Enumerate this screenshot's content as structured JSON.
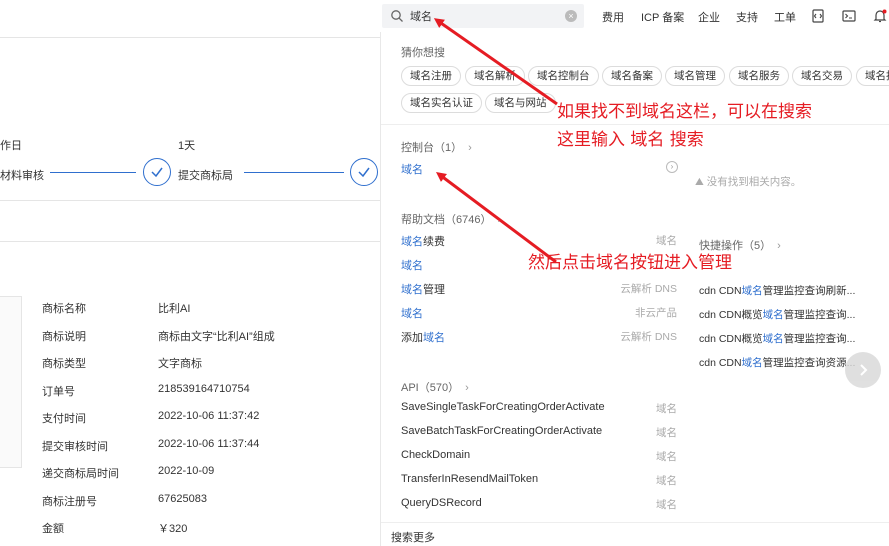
{
  "search": {
    "value": "域名"
  },
  "nav": [
    {
      "label": "费用"
    },
    {
      "label": "ICP 备案"
    },
    {
      "label": "企业"
    },
    {
      "label": "支持"
    },
    {
      "label": "工单"
    }
  ],
  "background": {
    "steps": {
      "label_top_1": "作日",
      "label_top_2": "1天",
      "step_1": "材料审核",
      "step_2": "提交商标局"
    },
    "info": [
      {
        "label": "商标名称",
        "value": "比利AI"
      },
      {
        "label": "商标说明",
        "value": "商标由文字“比利AI”组成"
      },
      {
        "label": "商标类型",
        "value": "文字商标"
      },
      {
        "label": "订单号",
        "value": "218539164710754"
      },
      {
        "label": "支付时间",
        "value": "2022-10-06 11:37:42"
      },
      {
        "label": "提交审核时间",
        "value": "2022-10-06 11:37:44"
      },
      {
        "label": "递交商标局时间",
        "value": "2022-10-09"
      },
      {
        "label": "商标注册号",
        "value": "67625083"
      },
      {
        "label": "金额",
        "value": "￥320"
      }
    ]
  },
  "dropdown": {
    "guess_title": "猜你想搜",
    "tags": [
      "域名注册",
      "域名解析",
      "域名控制台",
      "域名备案",
      "域名管理",
      "域名服务",
      "域名交易",
      "域名抢",
      "域名实名认证",
      "域名与网站"
    ],
    "console": {
      "title": "控制台（1）",
      "items": [
        {
          "pre": "",
          "hl": "域名",
          "post": ""
        }
      ],
      "no_result": "没有找到相关内容。"
    },
    "docs": {
      "title": "帮助文档（6746）",
      "items": [
        {
          "pre": "",
          "hl": "域名",
          "post": "续费",
          "right": "域名"
        },
        {
          "pre": "",
          "hl": "域名",
          "post": "",
          "right": ""
        },
        {
          "pre": "",
          "hl": "域名",
          "post": "管理",
          "right": "云解析 DNS"
        },
        {
          "pre": "",
          "hl": "域名",
          "post": "",
          "right": "非云产品"
        },
        {
          "pre": "添加",
          "hl": "域名",
          "post": "",
          "right": "云解析 DNS"
        }
      ]
    },
    "quick": {
      "title": "快捷操作（5）",
      "items": [
        {
          "pre": "cdn CDN",
          "hl": "域名",
          "post": "管理监控查询刷新..."
        },
        {
          "pre": "cdn CDN概览",
          "hl": "域名",
          "post": "管理监控查询..."
        },
        {
          "pre": "cdn CDN概览",
          "hl": "域名",
          "post": "管理监控查询..."
        },
        {
          "pre": "cdn CDN",
          "hl": "域名",
          "post": "管理监控查询资源..."
        }
      ]
    },
    "api": {
      "title": "API（570）",
      "items": [
        {
          "name": "SaveSingleTaskForCreatingOrderActivate",
          "right": "域名"
        },
        {
          "name": "SaveBatchTaskForCreatingOrderActivate",
          "right": "域名"
        },
        {
          "name": "CheckDomain",
          "right": "域名"
        },
        {
          "name": "TransferInResendMailToken",
          "right": "域名"
        },
        {
          "name": "QueryDSRecord",
          "right": "域名"
        }
      ]
    },
    "more": "搜索更多"
  },
  "annotations": {
    "line1": "如果找不到域名这栏，可以在搜索",
    "line2": "这里输入 域名 搜索",
    "line3": "然后点击域名按钮进入管理"
  },
  "colors": {
    "accent": "#2f6fce",
    "annotation": "#e51c23"
  }
}
